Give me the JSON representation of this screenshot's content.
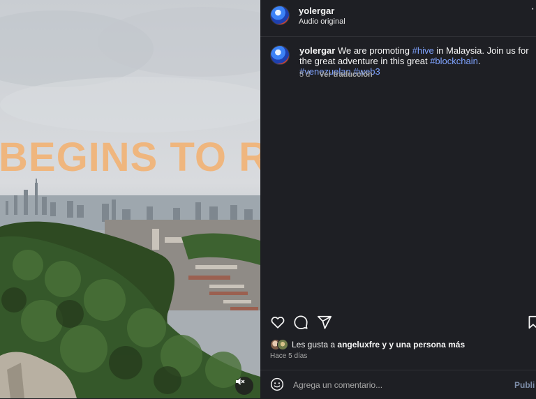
{
  "post": {
    "author": "yolergar",
    "audio_label": "Audio original",
    "caption_parts": [
      {
        "text": "We are promoting ",
        "tag": false
      },
      {
        "text": "#hive",
        "tag": true
      },
      {
        "text": " in Malaysia. Join us for the great adventure in this great ",
        "tag": false
      },
      {
        "text": "#blockchain",
        "tag": true
      },
      {
        "text": ". ",
        "tag": false
      },
      {
        "text": "#venezuelan",
        "tag": true
      },
      {
        "text": " ",
        "tag": false
      },
      {
        "text": "#web3",
        "tag": true
      }
    ],
    "age_short": "5 d",
    "translate_label": "Ver traducción",
    "likes_prefix": "Les gusta a ",
    "likes_bold": "angeluxfre y y una persona más",
    "posted_ago": "Hace 5 días",
    "comment_placeholder": "Agrega un comentario...",
    "publish_label": "Publi"
  },
  "media": {
    "overlay_text": "BEGINS TO RI"
  },
  "icons": {
    "like": "heart-icon",
    "comment": "comment-icon",
    "share": "send-icon",
    "save": "bookmark-icon",
    "emoji": "emoji-icon",
    "mute": "mute-icon",
    "more": "more-icon"
  },
  "colors": {
    "background": "#1e1f24",
    "hashtag": "#7fa3ff",
    "overlay_text": "#f2b477",
    "muted_text": "#a8a8a8"
  }
}
